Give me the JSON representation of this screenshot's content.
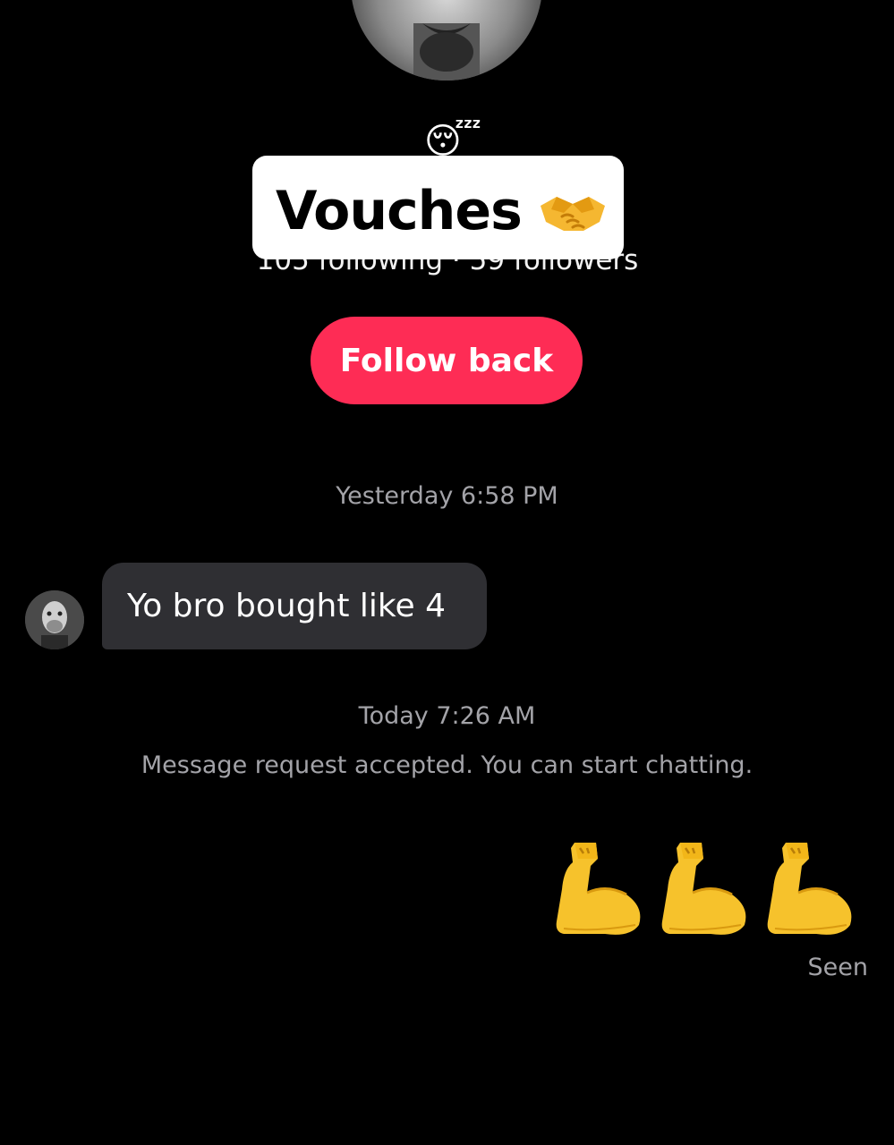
{
  "profile": {
    "stats": "105 following · 59 followers",
    "status_emoji": "😴"
  },
  "sticker": {
    "text": "Vouches",
    "icon": "handshake-icon"
  },
  "follow_button": {
    "label": "Follow back",
    "color": "#fe2c55"
  },
  "conversation": {
    "timestamp_1": "Yesterday 6:58 PM",
    "incoming_message": "Yo bro bought like 4",
    "timestamp_2": "Today 7:26 AM",
    "system_message": "Message request accepted. You can start chatting.",
    "outgoing_emoji_icons": [
      "flexed-biceps-icon",
      "flexed-biceps-icon",
      "flexed-biceps-icon"
    ],
    "read_status": "Seen"
  },
  "colors": {
    "background": "#000000",
    "bubble": "#2f2f33",
    "muted_text": "#a3a3a8"
  }
}
